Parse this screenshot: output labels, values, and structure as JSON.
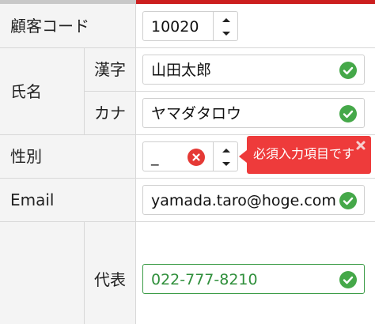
{
  "form": {
    "customer_code": {
      "label": "顧客コード",
      "value": "10020"
    },
    "name": {
      "label": "氏名",
      "kanji": {
        "label": "漢字",
        "value": "山田太郎"
      },
      "kana": {
        "label": "カナ",
        "value": "ヤマダタロウ"
      }
    },
    "gender": {
      "label": "性別",
      "value": "_"
    },
    "email": {
      "label": "Email",
      "value": "yamada.taro@hoge.com"
    },
    "phone": {
      "label": "代表",
      "value": "022-777-8210"
    }
  },
  "validation": {
    "tooltip_text": "必須入力項目です"
  },
  "colors": {
    "accent_red": "#cc1f1f",
    "error_red": "#e53935",
    "tooltip_red": "#ee3b3b",
    "valid_green": "#45a849",
    "label_bg": "#f4f4f4"
  },
  "icons": {
    "valid": "check-circle-icon",
    "error": "x-circle-icon",
    "spinner_up": "caret-up-icon",
    "spinner_down": "caret-down-icon",
    "tooltip_close": "close-icon"
  }
}
